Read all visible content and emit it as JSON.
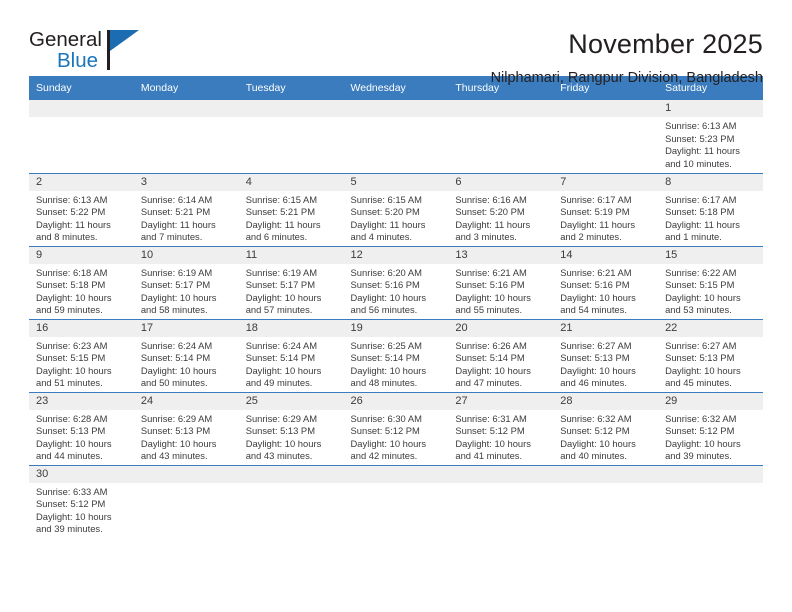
{
  "brand": {
    "name_part1": "General",
    "name_part2": "Blue"
  },
  "header": {
    "title": "November 2025",
    "subtitle": "Nilphamari, Rangpur Division, Bangladesh"
  },
  "colors": {
    "header_blue": "#3a7cbe",
    "daynum_gray": "#efefef",
    "brand_blue": "#1b75bb",
    "text": "#3c3c3c"
  },
  "weekday_headers": [
    "Sunday",
    "Monday",
    "Tuesday",
    "Wednesday",
    "Thursday",
    "Friday",
    "Saturday"
  ],
  "weeks": [
    [
      {
        "blank": true,
        "day": ""
      },
      {
        "blank": true,
        "day": ""
      },
      {
        "blank": true,
        "day": ""
      },
      {
        "blank": true,
        "day": ""
      },
      {
        "blank": true,
        "day": ""
      },
      {
        "blank": true,
        "day": ""
      },
      {
        "blank": false,
        "day": "1",
        "sunrise": "Sunrise: 6:13 AM",
        "sunset": "Sunset: 5:23 PM",
        "daylight": "Daylight: 11 hours and 10 minutes."
      }
    ],
    [
      {
        "blank": false,
        "day": "2",
        "sunrise": "Sunrise: 6:13 AM",
        "sunset": "Sunset: 5:22 PM",
        "daylight": "Daylight: 11 hours and 8 minutes."
      },
      {
        "blank": false,
        "day": "3",
        "sunrise": "Sunrise: 6:14 AM",
        "sunset": "Sunset: 5:21 PM",
        "daylight": "Daylight: 11 hours and 7 minutes."
      },
      {
        "blank": false,
        "day": "4",
        "sunrise": "Sunrise: 6:15 AM",
        "sunset": "Sunset: 5:21 PM",
        "daylight": "Daylight: 11 hours and 6 minutes."
      },
      {
        "blank": false,
        "day": "5",
        "sunrise": "Sunrise: 6:15 AM",
        "sunset": "Sunset: 5:20 PM",
        "daylight": "Daylight: 11 hours and 4 minutes."
      },
      {
        "blank": false,
        "day": "6",
        "sunrise": "Sunrise: 6:16 AM",
        "sunset": "Sunset: 5:20 PM",
        "daylight": "Daylight: 11 hours and 3 minutes."
      },
      {
        "blank": false,
        "day": "7",
        "sunrise": "Sunrise: 6:17 AM",
        "sunset": "Sunset: 5:19 PM",
        "daylight": "Daylight: 11 hours and 2 minutes."
      },
      {
        "blank": false,
        "day": "8",
        "sunrise": "Sunrise: 6:17 AM",
        "sunset": "Sunset: 5:18 PM",
        "daylight": "Daylight: 11 hours and 1 minute."
      }
    ],
    [
      {
        "blank": false,
        "day": "9",
        "sunrise": "Sunrise: 6:18 AM",
        "sunset": "Sunset: 5:18 PM",
        "daylight": "Daylight: 10 hours and 59 minutes."
      },
      {
        "blank": false,
        "day": "10",
        "sunrise": "Sunrise: 6:19 AM",
        "sunset": "Sunset: 5:17 PM",
        "daylight": "Daylight: 10 hours and 58 minutes."
      },
      {
        "blank": false,
        "day": "11",
        "sunrise": "Sunrise: 6:19 AM",
        "sunset": "Sunset: 5:17 PM",
        "daylight": "Daylight: 10 hours and 57 minutes."
      },
      {
        "blank": false,
        "day": "12",
        "sunrise": "Sunrise: 6:20 AM",
        "sunset": "Sunset: 5:16 PM",
        "daylight": "Daylight: 10 hours and 56 minutes."
      },
      {
        "blank": false,
        "day": "13",
        "sunrise": "Sunrise: 6:21 AM",
        "sunset": "Sunset: 5:16 PM",
        "daylight": "Daylight: 10 hours and 55 minutes."
      },
      {
        "blank": false,
        "day": "14",
        "sunrise": "Sunrise: 6:21 AM",
        "sunset": "Sunset: 5:16 PM",
        "daylight": "Daylight: 10 hours and 54 minutes."
      },
      {
        "blank": false,
        "day": "15",
        "sunrise": "Sunrise: 6:22 AM",
        "sunset": "Sunset: 5:15 PM",
        "daylight": "Daylight: 10 hours and 53 minutes."
      }
    ],
    [
      {
        "blank": false,
        "day": "16",
        "sunrise": "Sunrise: 6:23 AM",
        "sunset": "Sunset: 5:15 PM",
        "daylight": "Daylight: 10 hours and 51 minutes."
      },
      {
        "blank": false,
        "day": "17",
        "sunrise": "Sunrise: 6:24 AM",
        "sunset": "Sunset: 5:14 PM",
        "daylight": "Daylight: 10 hours and 50 minutes."
      },
      {
        "blank": false,
        "day": "18",
        "sunrise": "Sunrise: 6:24 AM",
        "sunset": "Sunset: 5:14 PM",
        "daylight": "Daylight: 10 hours and 49 minutes."
      },
      {
        "blank": false,
        "day": "19",
        "sunrise": "Sunrise: 6:25 AM",
        "sunset": "Sunset: 5:14 PM",
        "daylight": "Daylight: 10 hours and 48 minutes."
      },
      {
        "blank": false,
        "day": "20",
        "sunrise": "Sunrise: 6:26 AM",
        "sunset": "Sunset: 5:14 PM",
        "daylight": "Daylight: 10 hours and 47 minutes."
      },
      {
        "blank": false,
        "day": "21",
        "sunrise": "Sunrise: 6:27 AM",
        "sunset": "Sunset: 5:13 PM",
        "daylight": "Daylight: 10 hours and 46 minutes."
      },
      {
        "blank": false,
        "day": "22",
        "sunrise": "Sunrise: 6:27 AM",
        "sunset": "Sunset: 5:13 PM",
        "daylight": "Daylight: 10 hours and 45 minutes."
      }
    ],
    [
      {
        "blank": false,
        "day": "23",
        "sunrise": "Sunrise: 6:28 AM",
        "sunset": "Sunset: 5:13 PM",
        "daylight": "Daylight: 10 hours and 44 minutes."
      },
      {
        "blank": false,
        "day": "24",
        "sunrise": "Sunrise: 6:29 AM",
        "sunset": "Sunset: 5:13 PM",
        "daylight": "Daylight: 10 hours and 43 minutes."
      },
      {
        "blank": false,
        "day": "25",
        "sunrise": "Sunrise: 6:29 AM",
        "sunset": "Sunset: 5:13 PM",
        "daylight": "Daylight: 10 hours and 43 minutes."
      },
      {
        "blank": false,
        "day": "26",
        "sunrise": "Sunrise: 6:30 AM",
        "sunset": "Sunset: 5:12 PM",
        "daylight": "Daylight: 10 hours and 42 minutes."
      },
      {
        "blank": false,
        "day": "27",
        "sunrise": "Sunrise: 6:31 AM",
        "sunset": "Sunset: 5:12 PM",
        "daylight": "Daylight: 10 hours and 41 minutes."
      },
      {
        "blank": false,
        "day": "28",
        "sunrise": "Sunrise: 6:32 AM",
        "sunset": "Sunset: 5:12 PM",
        "daylight": "Daylight: 10 hours and 40 minutes."
      },
      {
        "blank": false,
        "day": "29",
        "sunrise": "Sunrise: 6:32 AM",
        "sunset": "Sunset: 5:12 PM",
        "daylight": "Daylight: 10 hours and 39 minutes."
      }
    ],
    [
      {
        "blank": false,
        "day": "30",
        "sunrise": "Sunrise: 6:33 AM",
        "sunset": "Sunset: 5:12 PM",
        "daylight": "Daylight: 10 hours and 39 minutes."
      },
      {
        "blank": true,
        "day": ""
      },
      {
        "blank": true,
        "day": ""
      },
      {
        "blank": true,
        "day": ""
      },
      {
        "blank": true,
        "day": ""
      },
      {
        "blank": true,
        "day": ""
      },
      {
        "blank": true,
        "day": ""
      }
    ]
  ]
}
